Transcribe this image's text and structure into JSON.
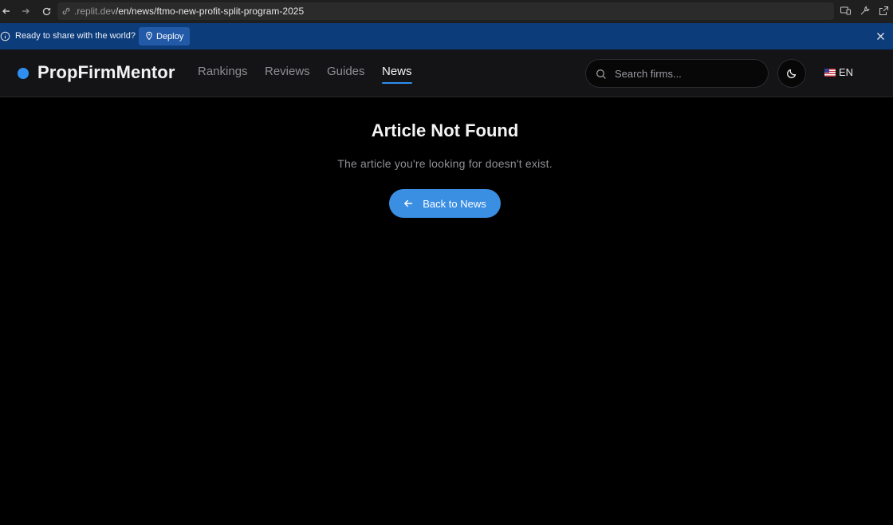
{
  "browser": {
    "url_host": ".replit.dev",
    "url_path": "/en/news/ftmo-new-profit-split-program-2025"
  },
  "banner": {
    "message": "Ready to share with the world?",
    "deploy_label": "Deploy"
  },
  "header": {
    "brand": "PropFirmMentor",
    "nav": [
      {
        "label": "Rankings",
        "active": false
      },
      {
        "label": "Reviews",
        "active": false
      },
      {
        "label": "Guides",
        "active": false
      },
      {
        "label": "News",
        "active": true
      }
    ],
    "search_placeholder": "Search firms...",
    "language": "EN"
  },
  "main": {
    "title": "Article Not Found",
    "subtitle": "The article you're looking for doesn't exist.",
    "back_label": "Back to News"
  },
  "colors": {
    "accent": "#3b8fe3",
    "banner_bg": "#0d3c7a",
    "header_bg": "#141416",
    "page_bg": "#000000"
  }
}
